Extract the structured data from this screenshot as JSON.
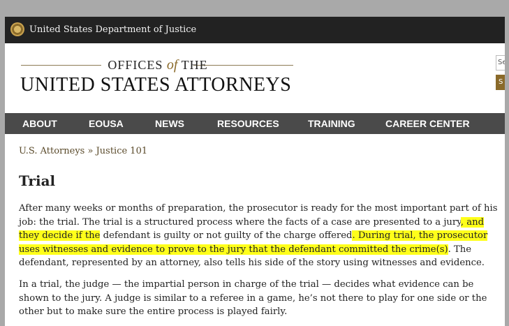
{
  "header": {
    "doj_title": "United States Department of Justice"
  },
  "masthead": {
    "offices": "OFFICES",
    "of": "of",
    "the": "THE",
    "usa": "UNITED STATES ATTORNEYS",
    "search_stub": "Se",
    "search_btn_stub": "S"
  },
  "nav": {
    "items": [
      {
        "label": "ABOUT"
      },
      {
        "label": "EOUSA"
      },
      {
        "label": "NEWS"
      },
      {
        "label": "RESOURCES"
      },
      {
        "label": "TRAINING"
      },
      {
        "label": "CAREER CENTER"
      }
    ]
  },
  "breadcrumb": {
    "home": "U.S. Attorneys",
    "sep": " » ",
    "current": "Justice 101"
  },
  "page": {
    "title": "Trial"
  },
  "paragraphs": {
    "p1_a": "After many weeks or months of preparation, the prosecutor is ready for the most important part of his job: the trial. The trial is a structured process where the facts of a case are presented to a jury",
    "p1_h1": ", and they decide if the",
    "p1_b": "defendant is guilty or not guilty of the charge offered",
    "p1_h2": ". During trial, the prosecutor uses witnesses and evidence to prove to the jury that the defendant committed the crime(s)",
    "p1_c": ". The defendant, represented by an attorney, also tells his side of the story using witnesses and evidence.",
    "p2": "In a trial, the judge — the impartial person in charge of the trial — decides what evidence can be shown to the jury. A judge is similar to a referee in a game, he’s not there to play for one side or the other but to make sure the entire process is played fairly."
  },
  "colors": {
    "highlight": "#ffff1a",
    "nav_bg": "#4a4a4a",
    "top_bar_bg": "#222222",
    "accent_gold": "#8a6a2a"
  }
}
